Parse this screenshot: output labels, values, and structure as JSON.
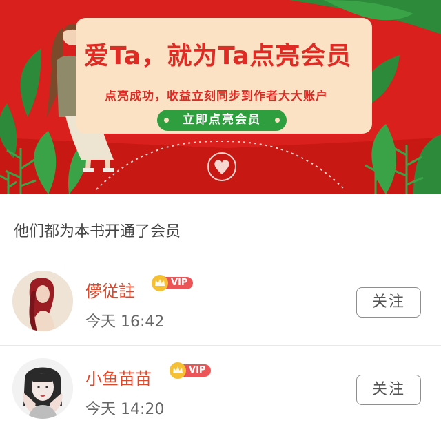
{
  "banner": {
    "title": "爱Ta，就为Ta点亮会员",
    "subtitle": "点亮成功，收益立刻同步到作者大大账户",
    "cta_label": "立即点亮会员"
  },
  "section": {
    "title": "他们都为本书开通了会员"
  },
  "members": [
    {
      "name": "儚従註",
      "vip_label": "VIP",
      "time": "今天 16:42",
      "follow_label": "关注"
    },
    {
      "name": "小鱼苗苗",
      "vip_label": "VIP",
      "time": "今天 14:20",
      "follow_label": "关注"
    }
  ],
  "colors": {
    "banner_red": "#d9201c",
    "card_cream": "#fbe2c4",
    "cta_green": "#2f9e3f",
    "name_orange": "#e0462a",
    "vip_pink": "#ec5557",
    "crown_gold": "#f6c035"
  }
}
